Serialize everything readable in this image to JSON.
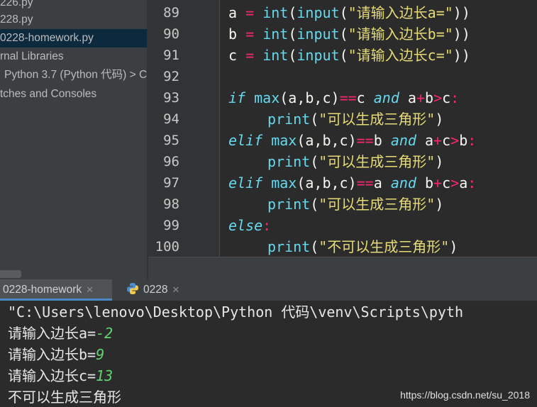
{
  "sidebar": {
    "items": [
      {
        "label": "226.py"
      },
      {
        "label": "228.py"
      },
      {
        "label": "0228-homework.py"
      },
      {
        "label": "rnal Libraries"
      },
      {
        "label": "Python 3.7 (Python 代码) >  C"
      },
      {
        "label": "tches and Consoles"
      }
    ]
  },
  "editor": {
    "line_numbers": [
      "89",
      "90",
      "91",
      "92",
      "93",
      "94",
      "95",
      "96",
      "97",
      "98",
      "99",
      "100"
    ],
    "code": {
      "l89": {
        "var": "a",
        "eq": "=",
        "fn1": "int",
        "p1": "(",
        "fn2": "input",
        "p2": "(",
        "str": "\"请输入边长a=\"",
        "p3": "))"
      },
      "l90": {
        "var": "b",
        "eq": "=",
        "fn1": "int",
        "p1": "(",
        "fn2": "input",
        "p2": "(",
        "str": "\"请输入边长b=\"",
        "p3": "))"
      },
      "l91": {
        "var": "c",
        "eq": "=",
        "fn1": "int",
        "p1": "(",
        "fn2": "input",
        "p2": "(",
        "str": "\"请输入边长c=\"",
        "p3": "))"
      },
      "l93": {
        "kw": "if",
        "fn": "max",
        "args": "(a,b,c)",
        "op1": "==",
        "v1": "c",
        "and": "and",
        "v2": "a",
        "op2": "+",
        "v3": "b",
        "op3": ">",
        "v4": "c",
        "colon": ":"
      },
      "l94": {
        "fn": "print",
        "p1": "(",
        "str": "\"可以生成三角形\"",
        "p2": ")"
      },
      "l95": {
        "kw": "elif",
        "fn": "max",
        "args": "(a,b,c)",
        "op1": "==",
        "v1": "b",
        "and": "and",
        "v2": "a",
        "op2": "+",
        "v3": "c",
        "op3": ">",
        "v4": "b",
        "colon": ":"
      },
      "l96": {
        "fn": "print",
        "p1": "(",
        "str": "\"可以生成三角形\"",
        "p2": ")"
      },
      "l97": {
        "kw": "elif",
        "fn": "max",
        "args": "(a,b,c)",
        "op1": "==",
        "v1": "a",
        "and": "and",
        "v2": "b",
        "op2": "+",
        "v3": "c",
        "op3": ">",
        "v4": "a",
        "colon": ":"
      },
      "l98": {
        "fn": "print",
        "p1": "(",
        "str": "\"可以生成三角形\"",
        "p2": ")"
      },
      "l99": {
        "kw": "else",
        "colon": ":"
      },
      "l100": {
        "fn": "print",
        "p1": "(",
        "str": "\"不可以生成三角形\"",
        "p2": ")"
      }
    }
  },
  "run": {
    "tabs": [
      {
        "label": "0228-homework",
        "close": "✕",
        "icon": "python-icon"
      },
      {
        "label": "0228",
        "close": "✕",
        "icon": "python-icon"
      }
    ],
    "console": {
      "command": "\"C:\\Users\\lenovo\\Desktop\\Python 代码\\venv\\Scripts\\pyth",
      "prompt_a": "请输入边长a=",
      "input_a": "-2",
      "prompt_b": "请输入边长b=",
      "input_b": "9",
      "prompt_c": "请输入边长c=",
      "input_c": "13",
      "result": "不可以生成三角形"
    }
  },
  "watermark": "https://blog.csdn.net/su_2018",
  "colors": {
    "keyword": "#66d9ef",
    "operator": "#f92672",
    "string": "#e6db74",
    "console_input": "#62d26f",
    "selection": "#0d293e"
  }
}
